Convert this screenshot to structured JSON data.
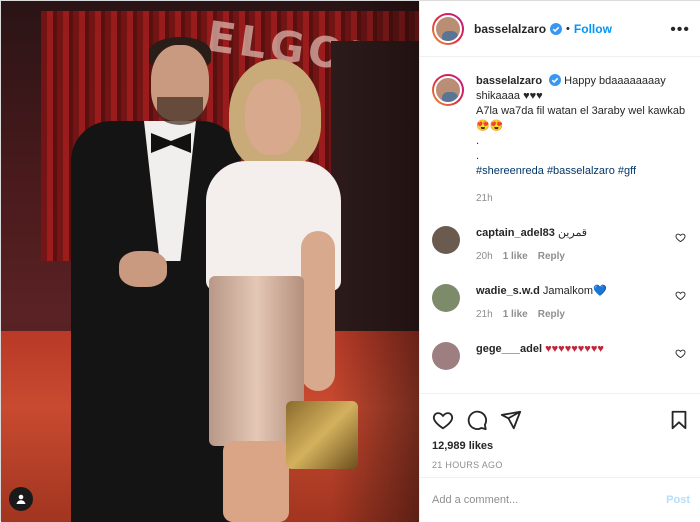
{
  "post": {
    "author": "basselalzaro",
    "follow_label": "Follow",
    "separator": "•",
    "more_label": "•••"
  },
  "caption": {
    "username": "basselalzaro",
    "line1": "Happy bdaaaaaaaay shikaaaa ♥♥♥",
    "line2": "A7la wa7da fil watan el 3araby wel kawkab 😍😍",
    "line3": ".",
    "line4": ".",
    "tags": "#shereenreda #basselalzaro #gff",
    "time": "21h"
  },
  "comments": [
    {
      "username": "captain_adel83",
      "text": "قمرين",
      "time": "20h",
      "likes": "1 like",
      "reply": "Reply",
      "avatar_color": "#6b5b4e"
    },
    {
      "username": "wadie_s.w.d",
      "text": "Jamalkom",
      "heart": "💙",
      "time": "21h",
      "likes": "1 like",
      "reply": "Reply",
      "avatar_color": "#7d8b6a"
    },
    {
      "username": "gege___adel",
      "text": "♥♥♥♥♥♥♥♥♥",
      "avatar_color": "#9d7f82"
    }
  ],
  "actions": {
    "likes": "12,989 likes",
    "timestamp": "21 HOURS AGO",
    "comment_placeholder": "Add a comment...",
    "post_label": "Post"
  },
  "photo": {
    "sign_text": "ELGOUNA"
  },
  "colors": {
    "accent": "#0095f6",
    "link": "#00376b",
    "muted": "#8e8e8e",
    "heart_red": "#ed4956"
  }
}
